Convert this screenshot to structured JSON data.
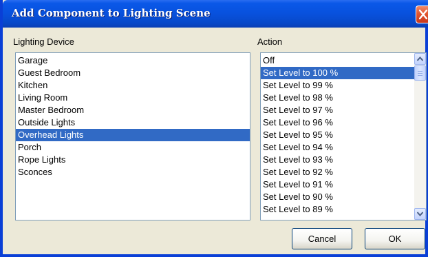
{
  "dialog": {
    "title": "Add Component to Lighting Scene"
  },
  "device_list": {
    "label": "Lighting Device",
    "items": [
      "Garage",
      "Guest Bedroom",
      "Kitchen",
      "Living Room",
      "Master Bedroom",
      "Outside Lights",
      "Overhead Lights",
      "Porch",
      "Rope Lights",
      "Sconces"
    ],
    "selected": "Overhead Lights"
  },
  "action_list": {
    "label": "Action",
    "items": [
      "Off",
      "Set Level to 100 %",
      "Set Level to 99 %",
      "Set Level to 98 %",
      "Set Level to 97 %",
      "Set Level to 96 %",
      "Set Level to 95 %",
      "Set Level to 94 %",
      "Set Level to 93 %",
      "Set Level to 92 %",
      "Set Level to 91 %",
      "Set Level to 90 %",
      "Set Level to 89 %"
    ],
    "selected": "Set Level to 100 %"
  },
  "buttons": {
    "cancel": "Cancel",
    "ok": "OK"
  },
  "icons": {
    "close": "close-icon",
    "scroll_up": "scroll-up-arrow-icon",
    "scroll_down": "scroll-down-arrow-icon"
  },
  "colors": {
    "titlebar": "#0851dd",
    "selection": "#316ac5",
    "dialog_bg": "#ece9d8",
    "close_button": "#e2562f"
  }
}
